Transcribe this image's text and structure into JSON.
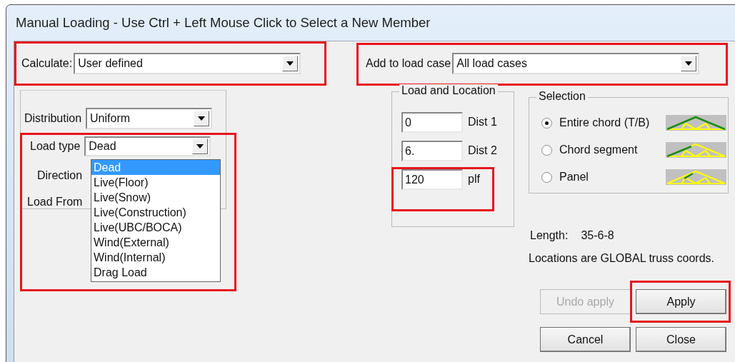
{
  "window": {
    "title": "Manual Loading - Use Ctrl + Left Mouse Click to Select a New Member"
  },
  "calculate": {
    "label": "Calculate:",
    "value": "User defined",
    "highlighted": true
  },
  "add_to_load_case": {
    "label": "Add to load case",
    "value": "All load cases",
    "highlighted": true
  },
  "distribution": {
    "label": "Distribution",
    "value": "Uniform"
  },
  "load_type": {
    "label": "Load type",
    "value": "Dead",
    "highlighted": true,
    "expanded": true,
    "options": [
      {
        "label": "Dead",
        "selected": true
      },
      {
        "label": "Live(Floor)",
        "selected": false
      },
      {
        "label": "Live(Snow)",
        "selected": false
      },
      {
        "label": "Live(Construction)",
        "selected": false
      },
      {
        "label": "Live(UBC/BOCA)",
        "selected": false
      },
      {
        "label": "Wind(External)",
        "selected": false
      },
      {
        "label": "Wind(Internal)",
        "selected": false
      },
      {
        "label": "Drag Load",
        "selected": false
      }
    ]
  },
  "direction": {
    "label": "Direction"
  },
  "load_from": {
    "label": "Load From"
  },
  "load_and_location": {
    "title": "Load and Location",
    "fields": [
      {
        "value": "0",
        "label": "Dist 1",
        "highlighted": false
      },
      {
        "value": "6.",
        "label": "Dist 2",
        "highlighted": false
      },
      {
        "value": "120",
        "label": "plf",
        "highlighted": true
      }
    ]
  },
  "selection": {
    "title": "Selection",
    "options": [
      {
        "label": "Entire chord (T/B)",
        "selected": true,
        "kind": "chord"
      },
      {
        "label": "Chord segment",
        "selected": false,
        "kind": "segment"
      },
      {
        "label": "Panel",
        "selected": false,
        "kind": "panel"
      }
    ]
  },
  "length": {
    "label": "Length:",
    "value": "35-6-8"
  },
  "note": "Locations are GLOBAL truss coords.",
  "buttons": [
    {
      "label": "Undo apply",
      "disabled": true,
      "highlighted": false
    },
    {
      "label": "Apply",
      "disabled": false,
      "highlighted": true
    },
    {
      "label": "Cancel",
      "disabled": false,
      "highlighted": false
    },
    {
      "label": "Close",
      "disabled": false,
      "highlighted": false
    }
  ]
}
